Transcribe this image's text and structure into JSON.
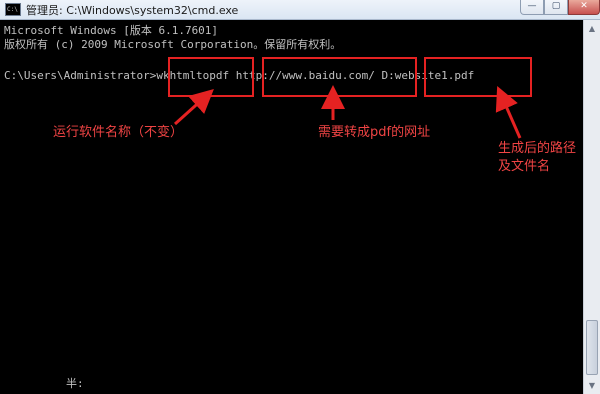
{
  "window": {
    "title": "管理员: C:\\Windows\\system32\\cmd.exe",
    "icon_text": "C:\\",
    "buttons": {
      "minimize": "—",
      "maximize": "▢",
      "close": "✕"
    }
  },
  "console": {
    "line1": "Microsoft Windows [版本 6.1.7601]",
    "line2": "版权所有 (c) 2009 Microsoft Corporation。保留所有权利。",
    "line3": "C:\\Users\\Administrator>wkhtmltopdf http://www.baidu.com/ D:website1.pdf",
    "ime_status": "半:"
  },
  "annotations": {
    "label1": "运行软件名称（不变）",
    "label2": "需要转成pdf的网址",
    "label3_line1": "生成后的路径",
    "label3_line2": "及文件名",
    "color": "#e52222"
  },
  "scrollbar": {
    "up": "▲",
    "down": "▼"
  }
}
